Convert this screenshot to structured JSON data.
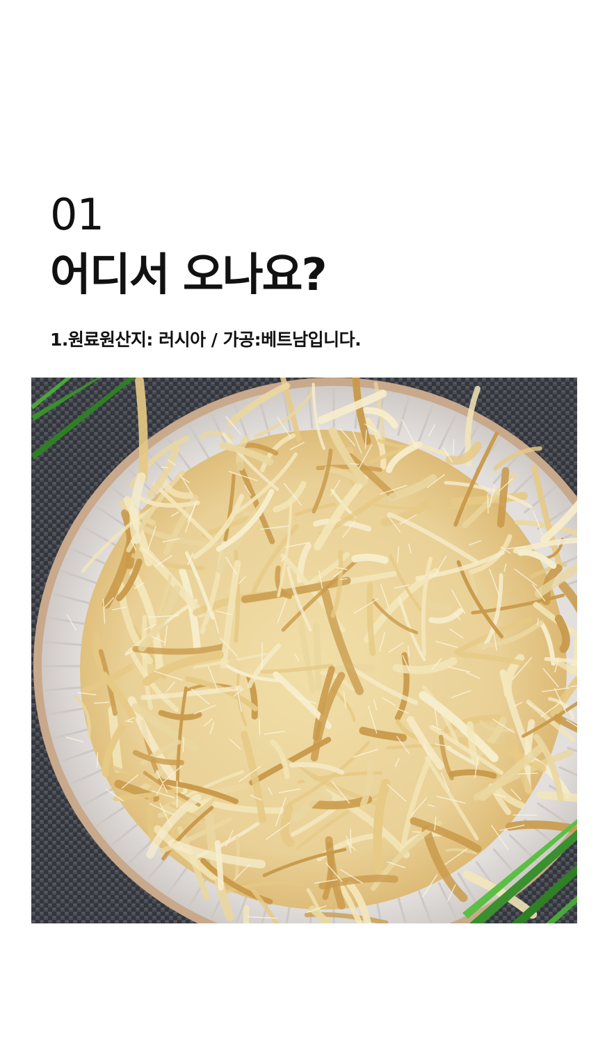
{
  "section": {
    "number": "01",
    "title": "어디서 오나요?",
    "description": "1.원료원산지: 러시아 / 가공:베트남입니다."
  },
  "photo": {
    "subject": "shredded dried squid on a white scalloped plate",
    "colors": {
      "mat": "#3b3d44",
      "plate": "#e6e3e1",
      "plate_rim": "#c9a98b",
      "squid_light": "#f3e6b9",
      "squid_mid": "#e6c985",
      "squid_dark": "#c99a4a",
      "leaf": "#3a8f2e"
    }
  }
}
